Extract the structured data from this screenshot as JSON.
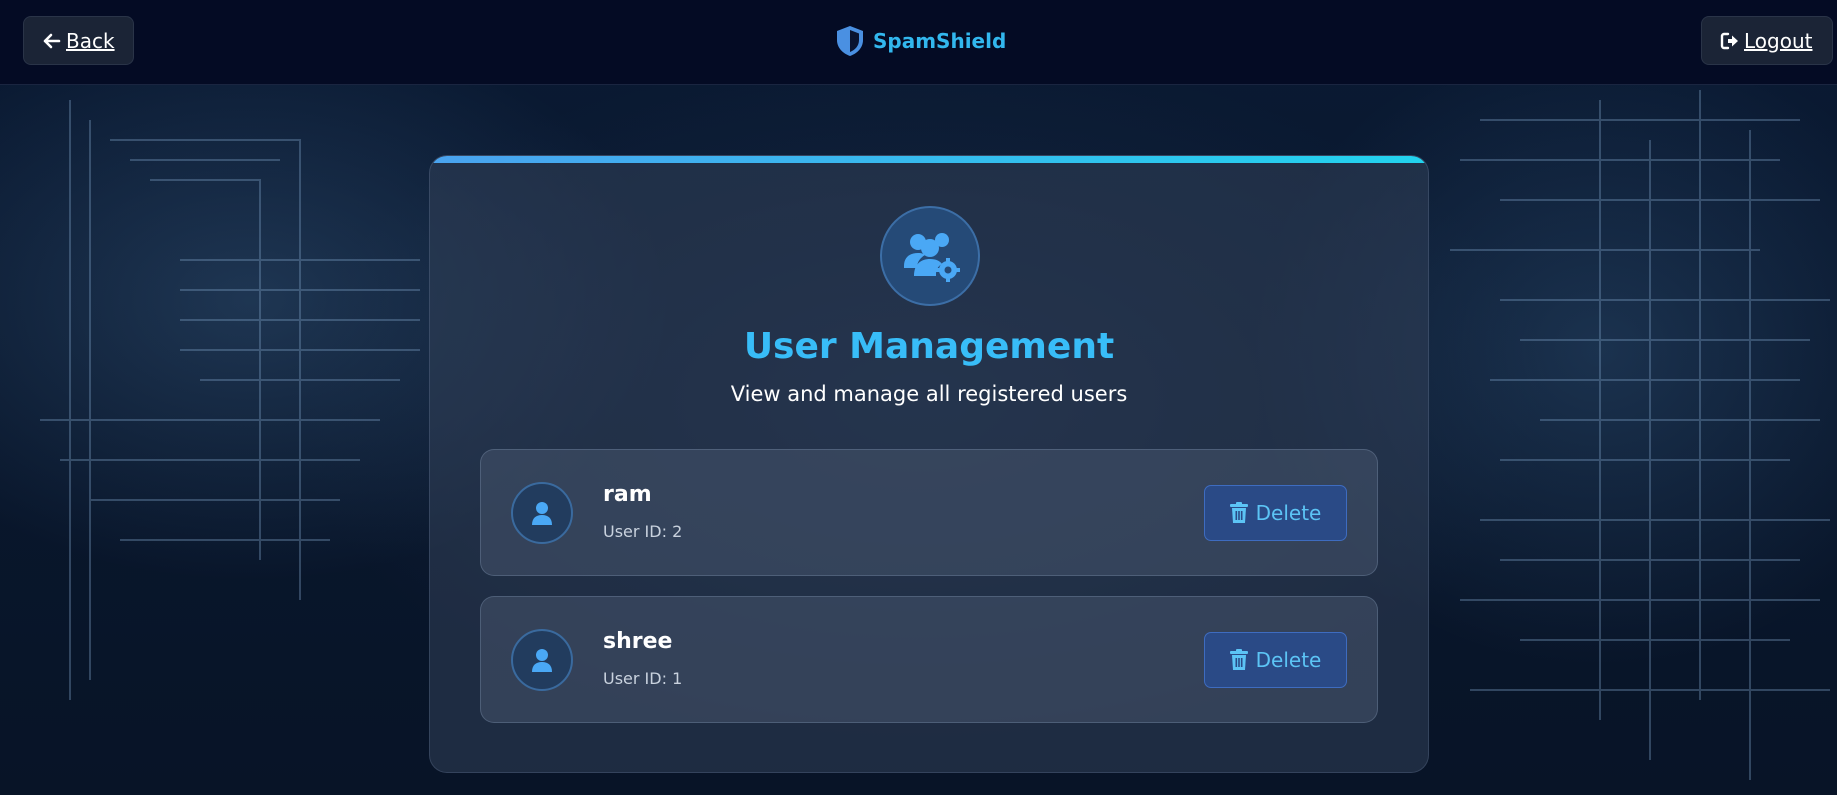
{
  "header": {
    "back_label": "Back",
    "brand_name": "SpamShield",
    "logout_label": "Logout"
  },
  "main": {
    "title": "User Management",
    "subtitle": "View and manage all registered users",
    "users": [
      {
        "name": "ram",
        "id_text": "User ID: 2",
        "delete_label": "Delete"
      },
      {
        "name": "shree",
        "id_text": "User ID: 1",
        "delete_label": "Delete"
      }
    ]
  },
  "icons": {
    "back": "arrow-left-icon",
    "brand": "shield-icon",
    "logout": "sign-out-icon",
    "hero": "users-gear-icon",
    "avatar": "user-icon",
    "delete": "trash-icon"
  },
  "colors": {
    "accent": "#38bdf8",
    "brand": "#32b7ee",
    "header_bg": "#040b24",
    "card_bar_start": "#4aa3ef",
    "card_bar_end": "#22d3ee",
    "delete_bg": "#2a4a86"
  }
}
